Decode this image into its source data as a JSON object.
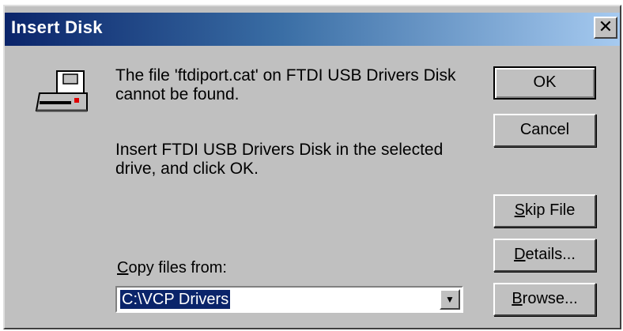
{
  "window": {
    "title": "Insert Disk",
    "close_glyph": "✕"
  },
  "message": {
    "line1": "The file 'ftdiport.cat' on FTDI USB Drivers Disk cannot be found.",
    "line2": "Insert FTDI USB Drivers Disk in the selected drive, and click OK."
  },
  "buttons": {
    "ok": "OK",
    "cancel": "Cancel",
    "skip_file_accel": "S",
    "skip_file_rest": "kip File",
    "details_accel": "D",
    "details_rest": "etails...",
    "browse_accel": "B",
    "browse_rest": "rowse..."
  },
  "copy_from": {
    "label_accel": "C",
    "label_rest": "opy files from:",
    "value": "C:\\VCP Drivers",
    "arrow_glyph": "▼"
  },
  "colors": {
    "title_gradient_start": "#0a246a",
    "title_gradient_end": "#a6caf0",
    "dialog_face": "#c0c0c0",
    "selection": "#0a246a"
  },
  "icons": {
    "dialog_icon": "floppy-drive-icon"
  }
}
